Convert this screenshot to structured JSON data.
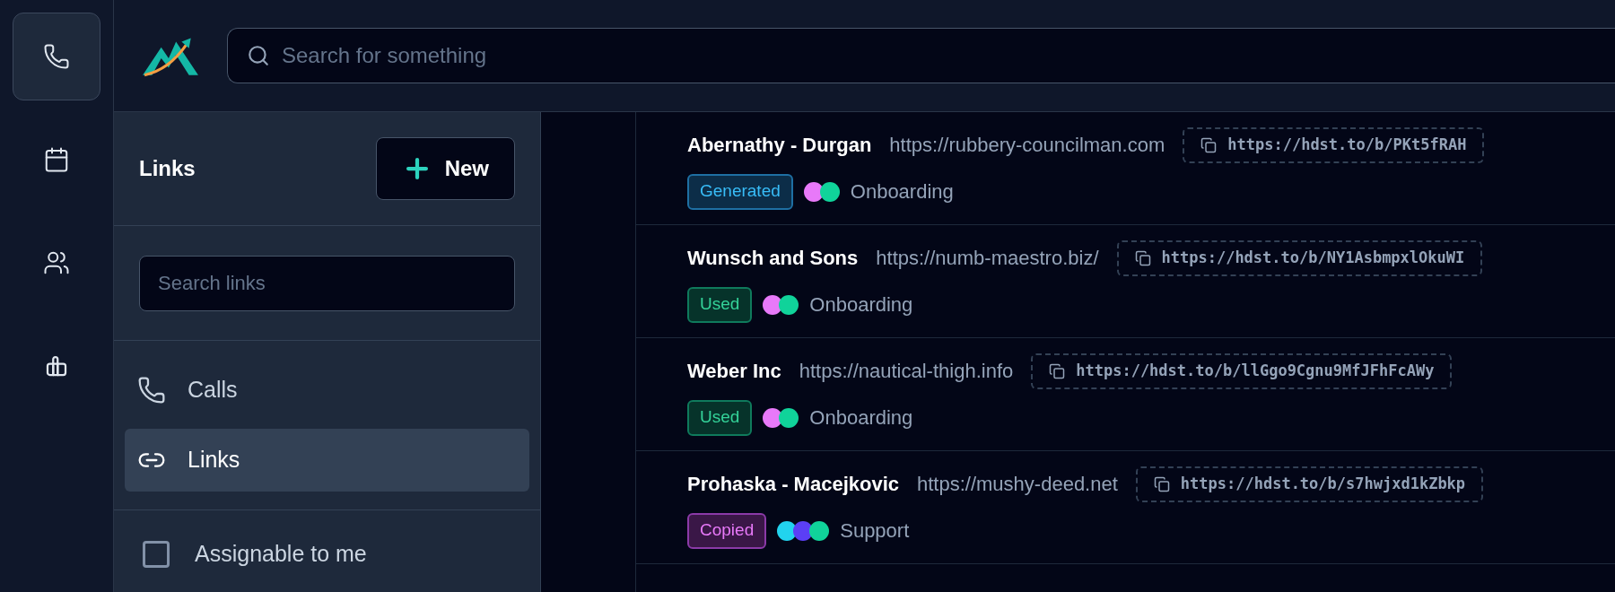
{
  "rail": [
    {
      "kind": "phone",
      "selected": true
    },
    {
      "kind": "calendar",
      "selected": false
    },
    {
      "kind": "users",
      "selected": false
    },
    {
      "kind": "chart",
      "selected": false
    }
  ],
  "search": {
    "placeholder": "Search for something"
  },
  "panel": {
    "title": "Links",
    "new_button": "New",
    "search": {
      "placeholder": "Search links"
    },
    "nav": [
      {
        "kind": "phone",
        "label": "Calls",
        "selected": false
      },
      {
        "kind": "link",
        "label": "Links",
        "selected": true
      }
    ],
    "filter": {
      "label": "Assignable to me",
      "checked": false
    }
  },
  "links": [
    {
      "name": "Abernathy - Durgan",
      "url": "https://rubbery-councilman.com",
      "short": "https://hdst.to/b/PKt5fRAH",
      "status": {
        "kind": "generated",
        "label": "Generated"
      },
      "dots": [
        {
          "color": "#e879f9"
        },
        {
          "color": "#10d39a"
        }
      ],
      "group": "Onboarding"
    },
    {
      "name": "Wunsch and Sons",
      "url": "https://numb-maestro.biz/",
      "short": "https://hdst.to/b/NY1AsbmpxlOkuWI",
      "status": {
        "kind": "used",
        "label": "Used"
      },
      "dots": [
        {
          "color": "#e879f9"
        },
        {
          "color": "#10d39a"
        }
      ],
      "group": "Onboarding"
    },
    {
      "name": "Weber Inc",
      "url": "https://nautical-thigh.info",
      "short": "https://hdst.to/b/llGgo9Cgnu9MfJFhFcAWy",
      "status": {
        "kind": "used",
        "label": "Used"
      },
      "dots": [
        {
          "color": "#e879f9"
        },
        {
          "color": "#10d39a"
        }
      ],
      "group": "Onboarding"
    },
    {
      "name": "Prohaska - Macejkovic",
      "url": "https://mushy-deed.net",
      "short": "https://hdst.to/b/s7hwjxd1kZbkp",
      "status": {
        "kind": "copied",
        "label": "Copied"
      },
      "dots": [
        {
          "color": "#22d3ee"
        },
        {
          "color": "#5b3ff5"
        },
        {
          "color": "#10d39a"
        }
      ],
      "group": "Support"
    }
  ]
}
